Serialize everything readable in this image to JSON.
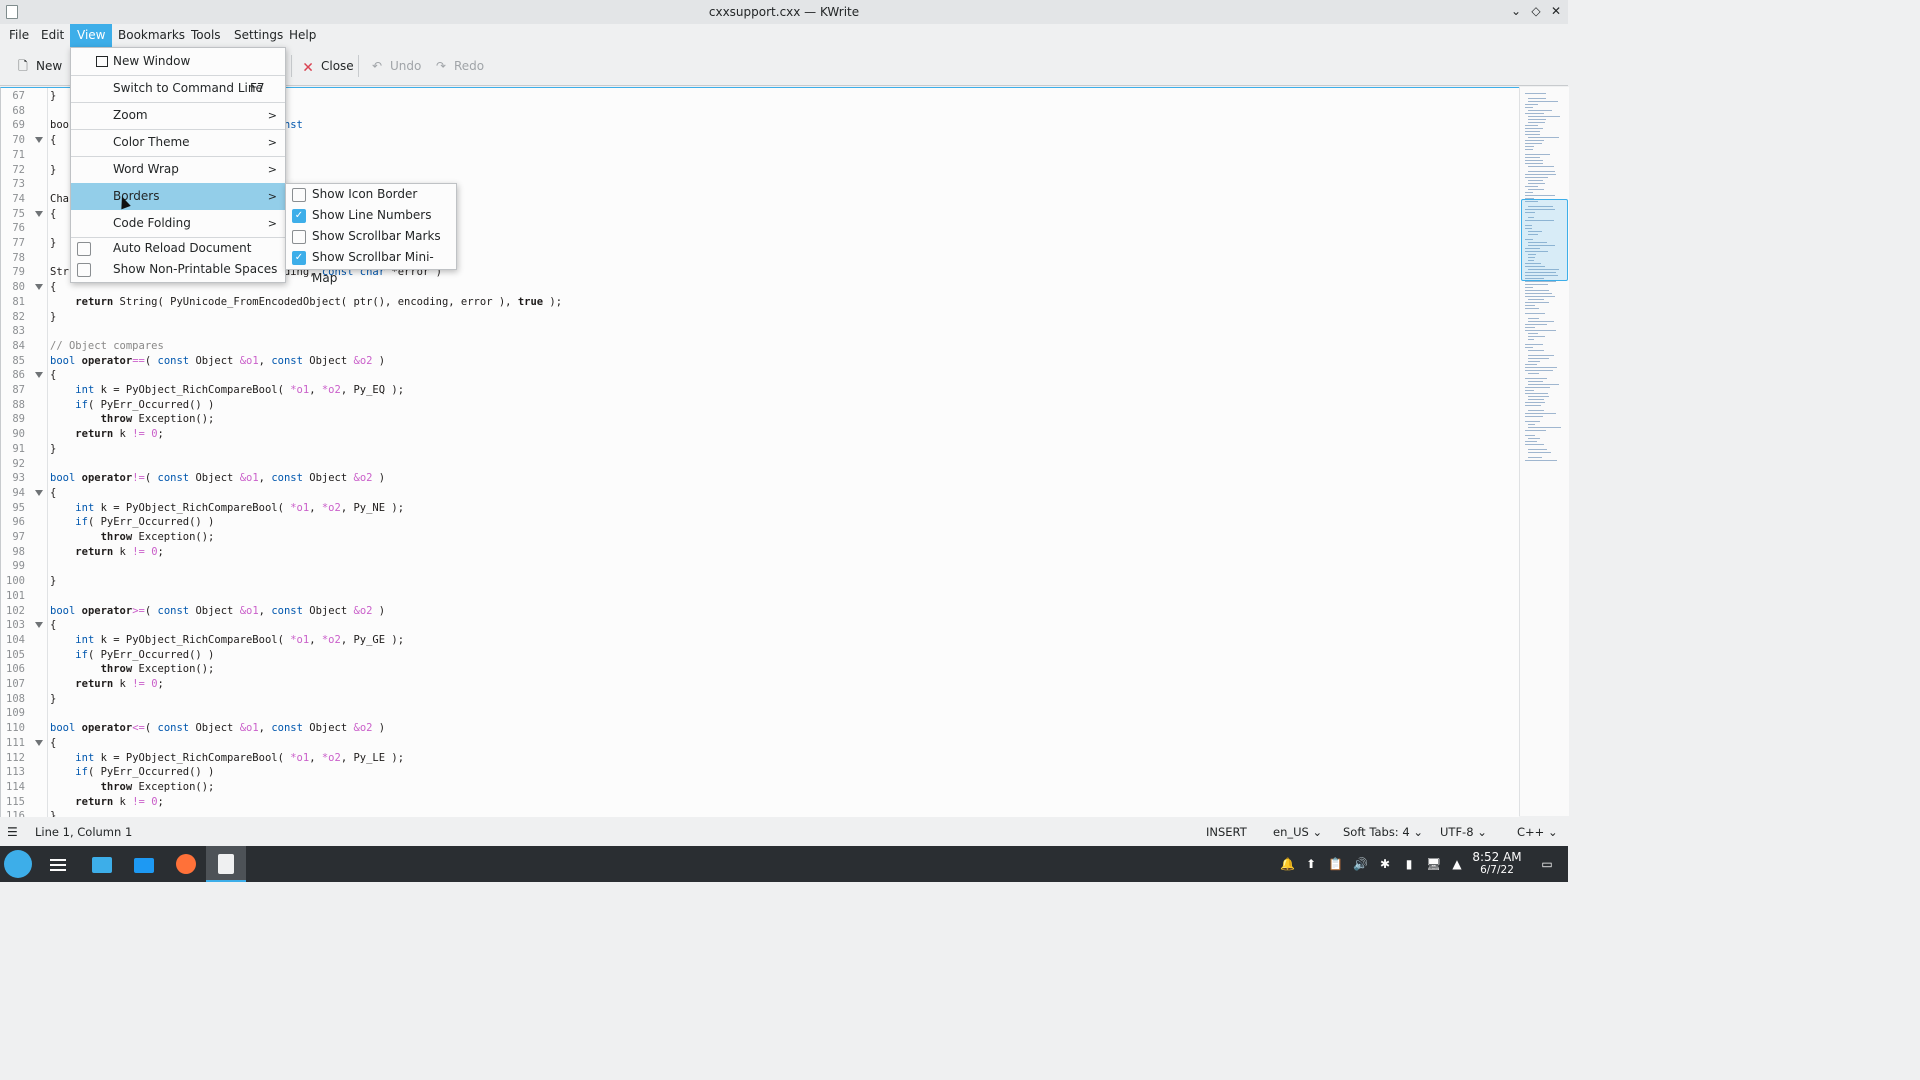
{
  "window": {
    "title": "cxxsupport.cxx — KWrite"
  },
  "menubar": [
    "File",
    "Edit",
    "View",
    "Bookmarks",
    "Tools",
    "Settings",
    "Help"
  ],
  "toolbar": {
    "new": "New",
    "close": "Close",
    "undo": "Undo",
    "redo": "Redo"
  },
  "view_menu": {
    "new_window": "New Window",
    "switch_cmd": "Switch to Command Line",
    "switch_cmd_shortcut": "F7",
    "zoom": "Zoom",
    "color_theme": "Color Theme",
    "word_wrap": "Word Wrap",
    "borders": "Borders",
    "code_folding": "Code Folding",
    "auto_reload": "Auto Reload Document",
    "auto_reload_checked": false,
    "non_printable": "Show Non-Printable Spaces",
    "non_printable_checked": false
  },
  "borders_menu": {
    "items": [
      {
        "label": "Show Icon Border",
        "checked": false
      },
      {
        "label": "Show Line Numbers",
        "checked": true
      },
      {
        "label": "Show Scrollbar Marks",
        "checked": false
      },
      {
        "label": "Show Scrollbar Mini-Map",
        "checked": true
      }
    ]
  },
  "code_lines": [
    [
      "67",
      "}",
      false
    ],
    [
      "68",
      "",
      false
    ],
    [
      "69",
      "boo                                const",
      false
    ],
    [
      "70",
      "{",
      true
    ],
    [
      "71",
      "",
      false
    ],
    [
      "72",
      "}",
      false
    ],
    [
      "73",
      "",
      false
    ],
    [
      "74",
      "Cha",
      false
    ],
    [
      "75",
      "{",
      true
    ],
    [
      "76",
      "",
      false
    ],
    [
      "77",
      "}",
      false
    ],
    [
      "78",
      "",
      false
    ],
    [
      "79",
      "Str                                 oding, const char *error )",
      false
    ],
    [
      "80",
      "{",
      true
    ],
    [
      "81",
      "    return String( PyUnicode_FromEncodedObject( ptr(), encoding, error ), true );",
      false
    ],
    [
      "82",
      "}",
      false
    ],
    [
      "83",
      "",
      false
    ],
    [
      "84",
      "// Object compares",
      false
    ],
    [
      "85",
      "bool operator==( const Object &o1, const Object &o2 )",
      false
    ],
    [
      "86",
      "{",
      true
    ],
    [
      "87",
      "    int k = PyObject_RichCompareBool( *o1, *o2, Py_EQ );",
      false
    ],
    [
      "88",
      "    if( PyErr_Occurred() )",
      false
    ],
    [
      "89",
      "        throw Exception();",
      false
    ],
    [
      "90",
      "    return k != 0;",
      false
    ],
    [
      "91",
      "}",
      false
    ],
    [
      "92",
      "",
      false
    ],
    [
      "93",
      "bool operator!=( const Object &o1, const Object &o2 )",
      false
    ],
    [
      "94",
      "{",
      true
    ],
    [
      "95",
      "    int k = PyObject_RichCompareBool( *o1, *o2, Py_NE );",
      false
    ],
    [
      "96",
      "    if( PyErr_Occurred() )",
      false
    ],
    [
      "97",
      "        throw Exception();",
      false
    ],
    [
      "98",
      "    return k != 0;",
      false
    ],
    [
      "99",
      "",
      false
    ],
    [
      "100",
      "}",
      false
    ],
    [
      "101",
      "",
      false
    ],
    [
      "102",
      "bool operator>=( const Object &o1, const Object &o2 )",
      false
    ],
    [
      "103",
      "{",
      true
    ],
    [
      "104",
      "    int k = PyObject_RichCompareBool( *o1, *o2, Py_GE );",
      false
    ],
    [
      "105",
      "    if( PyErr_Occurred() )",
      false
    ],
    [
      "106",
      "        throw Exception();",
      false
    ],
    [
      "107",
      "    return k != 0;",
      false
    ],
    [
      "108",
      "}",
      false
    ],
    [
      "109",
      "",
      false
    ],
    [
      "110",
      "bool operator<=( const Object &o1, const Object &o2 )",
      false
    ],
    [
      "111",
      "{",
      true
    ],
    [
      "112",
      "    int k = PyObject_RichCompareBool( *o1, *o2, Py_LE );",
      false
    ],
    [
      "113",
      "    if( PyErr_Occurred() )",
      false
    ],
    [
      "114",
      "        throw Exception();",
      false
    ],
    [
      "115",
      "    return k != 0;",
      false
    ],
    [
      "116",
      "}",
      false
    ]
  ],
  "statusbar": {
    "position": "Line 1, Column 1",
    "mode": "INSERT",
    "language": "en_US",
    "indent": "Soft Tabs: 4",
    "encoding": "UTF-8",
    "syntax": "C++"
  },
  "taskbar": {
    "time": "8:52 AM",
    "date": "6/7/22"
  },
  "colors": {
    "accent": "#3daee9",
    "taskbar": "#2a2e32",
    "keyword_type": "#0057ae"
  }
}
